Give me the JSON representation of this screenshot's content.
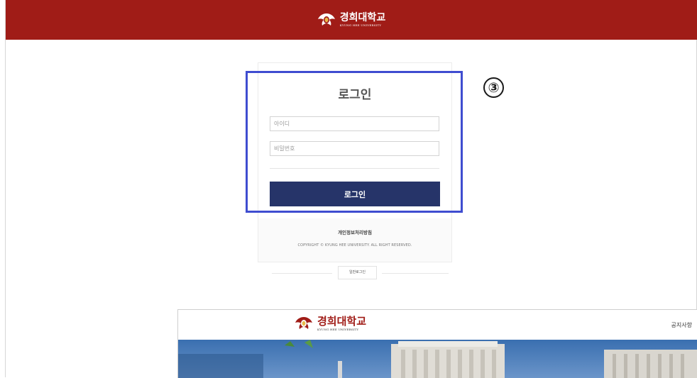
{
  "header": {
    "logo_korean": "경희대학교",
    "logo_english": "KYUNG HEE UNIVERSITY"
  },
  "login": {
    "title": "로그인",
    "id_placeholder": "아이디",
    "password_placeholder": "비밀번호",
    "button_label": "로그인",
    "privacy_link": "개인정보처리방침",
    "copyright": "COPYRIGHT © KYUNG HEE UNIVERSITY. ALL RIGHT RESERVED.",
    "general_login": "일반로그인"
  },
  "annotation": {
    "step_marker": "③",
    "highlight_color": "#3f4dd0"
  },
  "lower_page": {
    "logo_korean": "경희대학교",
    "logo_english": "KYUNG HEE UNIVERSITY",
    "notice_link": "공지사항"
  },
  "colors": {
    "brand_red": "#a01c17",
    "button_navy": "#263469"
  }
}
